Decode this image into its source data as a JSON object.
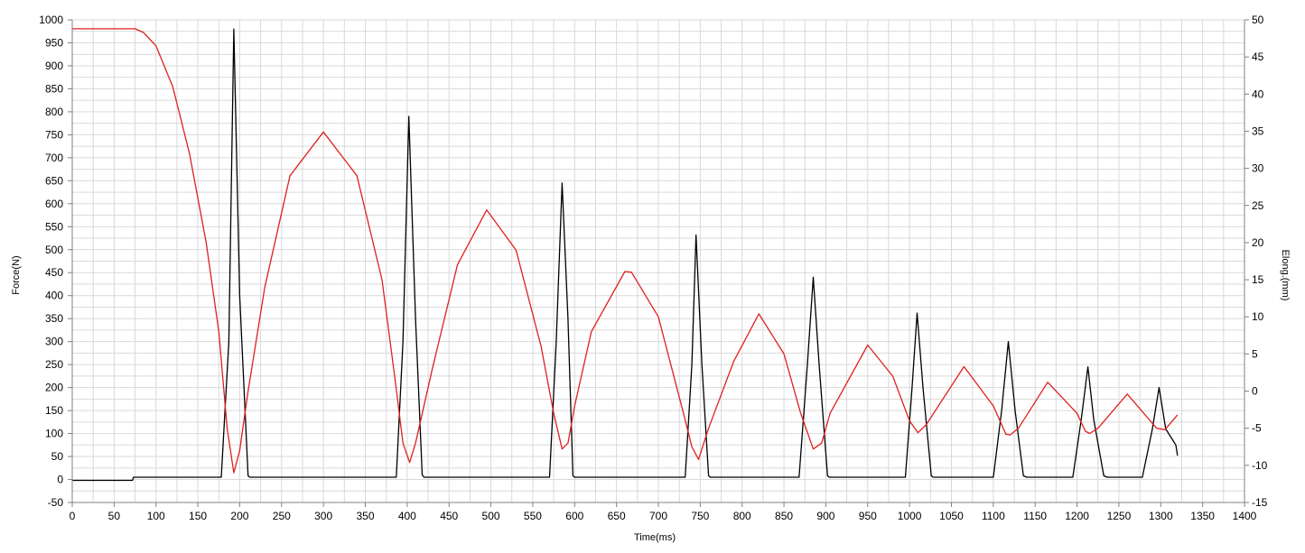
{
  "chart_data": {
    "type": "line",
    "title": "",
    "xlabel": "Time(ms)",
    "ylabel": "Force(N)",
    "y2label": "Elong.(mm)",
    "xlim": [
      0,
      1400
    ],
    "ylim": [
      -50,
      1000
    ],
    "y2lim": [
      -15,
      50
    ],
    "grid": true,
    "legend": "none",
    "x_ticks": [
      0,
      50,
      100,
      150,
      200,
      250,
      300,
      350,
      400,
      450,
      500,
      550,
      600,
      650,
      700,
      750,
      800,
      850,
      900,
      950,
      1000,
      1050,
      1100,
      1150,
      1200,
      1250,
      1300,
      1350,
      1400
    ],
    "y_ticks": [
      -50,
      0,
      50,
      100,
      150,
      200,
      250,
      300,
      350,
      400,
      450,
      500,
      550,
      600,
      650,
      700,
      750,
      800,
      850,
      900,
      950,
      1000
    ],
    "y2_ticks": [
      -15,
      -10,
      -5,
      0,
      5,
      10,
      15,
      20,
      25,
      30,
      35,
      40,
      45,
      50
    ],
    "series": [
      {
        "axis": "left",
        "color": "#000000",
        "x": [
          0,
          72,
          73,
          178,
          187,
          193,
          200,
          210,
          212,
          387,
          395,
          402,
          410,
          418,
          420,
          570,
          578,
          585,
          592,
          598,
          600,
          732,
          740,
          745,
          752,
          760,
          762,
          868,
          878,
          885,
          892,
          902,
          904,
          995,
          1003,
          1009,
          1016,
          1026,
          1028,
          1100,
          1110,
          1118,
          1126,
          1136,
          1140,
          1195,
          1205,
          1213,
          1220,
          1232,
          1236,
          1278,
          1290,
          1298,
          1306,
          1318,
          1320
        ],
        "values": [
          -2,
          -2,
          5,
          5,
          300,
          980,
          400,
          8,
          5,
          5,
          300,
          790,
          350,
          10,
          5,
          5,
          300,
          645,
          350,
          8,
          5,
          5,
          250,
          532,
          250,
          8,
          5,
          5,
          250,
          440,
          250,
          8,
          5,
          5,
          200,
          362,
          200,
          8,
          5,
          5,
          150,
          300,
          150,
          8,
          5,
          5,
          130,
          245,
          130,
          8,
          5,
          5,
          110,
          200,
          110,
          75,
          52
        ]
      },
      {
        "axis": "right",
        "color": "#e02020",
        "x": [
          0,
          75,
          85,
          100,
          120,
          140,
          160,
          175,
          185,
          193,
          200,
          210,
          230,
          260,
          300,
          340,
          370,
          385,
          395,
          403,
          410,
          430,
          460,
          495,
          530,
          560,
          575,
          585,
          592,
          600,
          620,
          660,
          668,
          700,
          730,
          740,
          748,
          760,
          790,
          820,
          850,
          870,
          885,
          895,
          905,
          950,
          980,
          1000,
          1010,
          1020,
          1065,
          1100,
          1115,
          1120,
          1130,
          1165,
          1200,
          1210,
          1215,
          1225,
          1260,
          1295,
          1305,
          1320
        ],
        "values": [
          48.8,
          48.8,
          48.3,
          46.5,
          41,
          32,
          20,
          8,
          -5,
          -11,
          -8,
          0,
          14,
          29,
          34.9,
          29,
          15,
          2,
          -7,
          -9.6,
          -7,
          3,
          17,
          24.4,
          19,
          6,
          -3,
          -7.8,
          -7,
          -2,
          8,
          16.1,
          16,
          10,
          -3,
          -7.5,
          -9.2,
          -5,
          4,
          10.4,
          5,
          -3,
          -7.8,
          -7,
          -3,
          6.2,
          2,
          -4,
          -5.6,
          -4.5,
          3.3,
          -2,
          -5.8,
          -5.9,
          -5,
          1.2,
          -3,
          -5.4,
          -5.7,
          -5,
          -0.4,
          -5,
          -5.2,
          -3.2
        ]
      }
    ]
  }
}
